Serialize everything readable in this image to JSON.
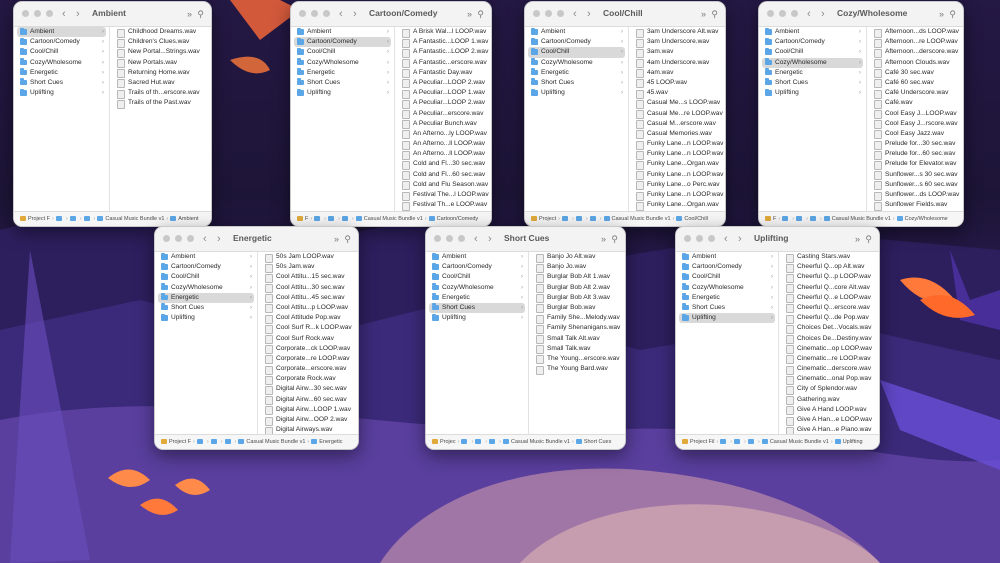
{
  "colors": {
    "accent_folder": "#5ba6e6",
    "drive": "#e0a93a",
    "selection": "#d9d9d9"
  },
  "sidebar_folders": [
    "Ambient",
    "Cartoon/Comedy",
    "Cool/Chill",
    "Cozy/Wholesome",
    "Energetic",
    "Short Cues",
    "Uplifting"
  ],
  "path_common": {
    "drive": "Project F",
    "bundle": "Casual Music Bundle v1"
  },
  "windows": [
    {
      "title": "Ambient",
      "selected": 0,
      "drive_label": "Project F",
      "files": [
        "Childhood Dreams.wav",
        "Children's Clues.wav",
        "New Portal...Strings.wav",
        "New Portals.wav",
        "Returning Home.wav",
        "Sacred Hut.wav",
        "Trails of th...erscore.wav",
        "Trails of the Past.wav"
      ]
    },
    {
      "title": "Cartoon/Comedy",
      "selected": 1,
      "drive_label": "F",
      "files": [
        "A Brisk Wal...l LOOP.wav",
        "A Fantastic...LOOP 1.wav",
        "A Fantastic...LOOP 2.wav",
        "A Fantastic...erscore.wav",
        "A Fantastic Day.wav",
        "A Peculiar...LOOP 2.wav",
        "A Peculiar...LOOP 1.wav",
        "A Peculiar...LOOP 2.wav",
        "A Peculiar...erscore.wav",
        "A Peculiar Bunch.wav",
        "An Afterno...ly LOOP.wav",
        "An Afterno...ll LOOP.wav",
        "An Afterno...ll LOOP.wav",
        "Cold and Fl...30 sec.wav",
        "Cold and Fl...60 sec.wav",
        "Cold and Flu Season.wav",
        "Festival The...l LOOP.wav",
        "Festival Th...e LOOP.wav"
      ]
    },
    {
      "title": "Cool/Chill",
      "selected": 2,
      "drive_label": "Project",
      "files": [
        "3am Underscore Alt.wav",
        "3am Underscore.wav",
        "3am.wav",
        "4am Underscore.wav",
        "4am.wav",
        "45 LOOP.wav",
        "45.wav",
        "Casual Me...s LOOP.wav",
        "Casual Me...re LOOP.wav",
        "Casual M...erscore.wav",
        "Casual Memories.wav",
        "Funky Lane...n LOOP.wav",
        "Funky Lane...n LOOP.wav",
        "Funky Lane...Organ.wav",
        "Funky Lane...n LOOP.wav",
        "Funky Lane...o Perc.wav",
        "Funky Lane...n LOOP.wav",
        "Funky Lane...Organ.wav"
      ]
    },
    {
      "title": "Cozy/Wholesome",
      "selected": 3,
      "drive_label": "F",
      "files": [
        "Afternoon...ds LOOP.wav",
        "Afternoon...re LOOP.wav",
        "Afternoon...derscore.wav",
        "Afternoon Clouds.wav",
        "Café 30 sec.wav",
        "Café 60 sec.wav",
        "Café Underscore.wav",
        "Café.wav",
        "Cool Easy J...LOOP.wav",
        "Cool Easy J...rscore.wav",
        "Cool Easy Jazz.wav",
        "Prelude for...30 sec.wav",
        "Prelude for...60 sec.wav",
        "Prelude for Elevator.wav",
        "Sunflower...s 30 sec.wav",
        "Sunflower...s 60 sec.wav",
        "Sunflower...ds LOOP.wav",
        "Sunflower Fields.wav"
      ]
    },
    {
      "title": "Energetic",
      "selected": 4,
      "drive_label": "Project F",
      "files": [
        "50s Jam LOOP.wav",
        "50s Jam.wav",
        "Cool Attitu...15 sec.wav",
        "Cool Attitu...30 sec.wav",
        "Cool Attitu...45 sec.wav",
        "Cool Attitu...p LOOP.wav",
        "Cool Attitude Pop.wav",
        "Cool Surf R...k LOOP.wav",
        "Cool Surf Rock.wav",
        "Corporate...ck LOOP.wav",
        "Corporate...re LOOP.wav",
        "Corporate...erscore.wav",
        "Corporate Rock.wav",
        "Digital Airw...30 sec.wav",
        "Digital Airw...60 sec.wav",
        "Digital Airw...LOOP 1.wav",
        "Digital Airw...OOP 2.wav",
        "Digital Airways.wav"
      ]
    },
    {
      "title": "Short Cues",
      "selected": 5,
      "drive_label": "Projec",
      "files": [
        "Banjo Jo Alt.wav",
        "Banjo Jo.wav",
        "Burglar Bob Alt 1.wav",
        "Burglar Bob Alt 2.wav",
        "Burglar Bob Alt 3.wav",
        "Burglar Bob.wav",
        "Family She...Melody.wav",
        "Family Shenanigans.wav",
        "Small Talk Alt.wav",
        "Small Talk.wav",
        "The Young...erscore.wav",
        "The Young Bard.wav"
      ]
    },
    {
      "title": "Uplifting",
      "selected": 6,
      "drive_label": "Project Fil",
      "files": [
        "Casting Stars.wav",
        "Cheerful Q...op Alt.wav",
        "Cheerful Q...p LOOP.wav",
        "Cheerful Q...core Alt.wav",
        "Cheerful Q...e LOOP.wav",
        "Cheerful Q...erscore.wav",
        "Cheerful Q...de Pop.wav",
        "Choices Det...Vocals.wav",
        "Choices De...Destiny.wav",
        "Cinematic...op LOOP.wav",
        "Cinematic...re LOOP.wav",
        "Cinematic...derscore.wav",
        "Cinematic...onal Pop.wav",
        "City of Splendor.wav",
        "Gathering.wav",
        "Give A Hand LOOP.wav",
        "Give A Han...e LOOP.wav",
        "Give A Han...e Piano.wav"
      ]
    }
  ]
}
